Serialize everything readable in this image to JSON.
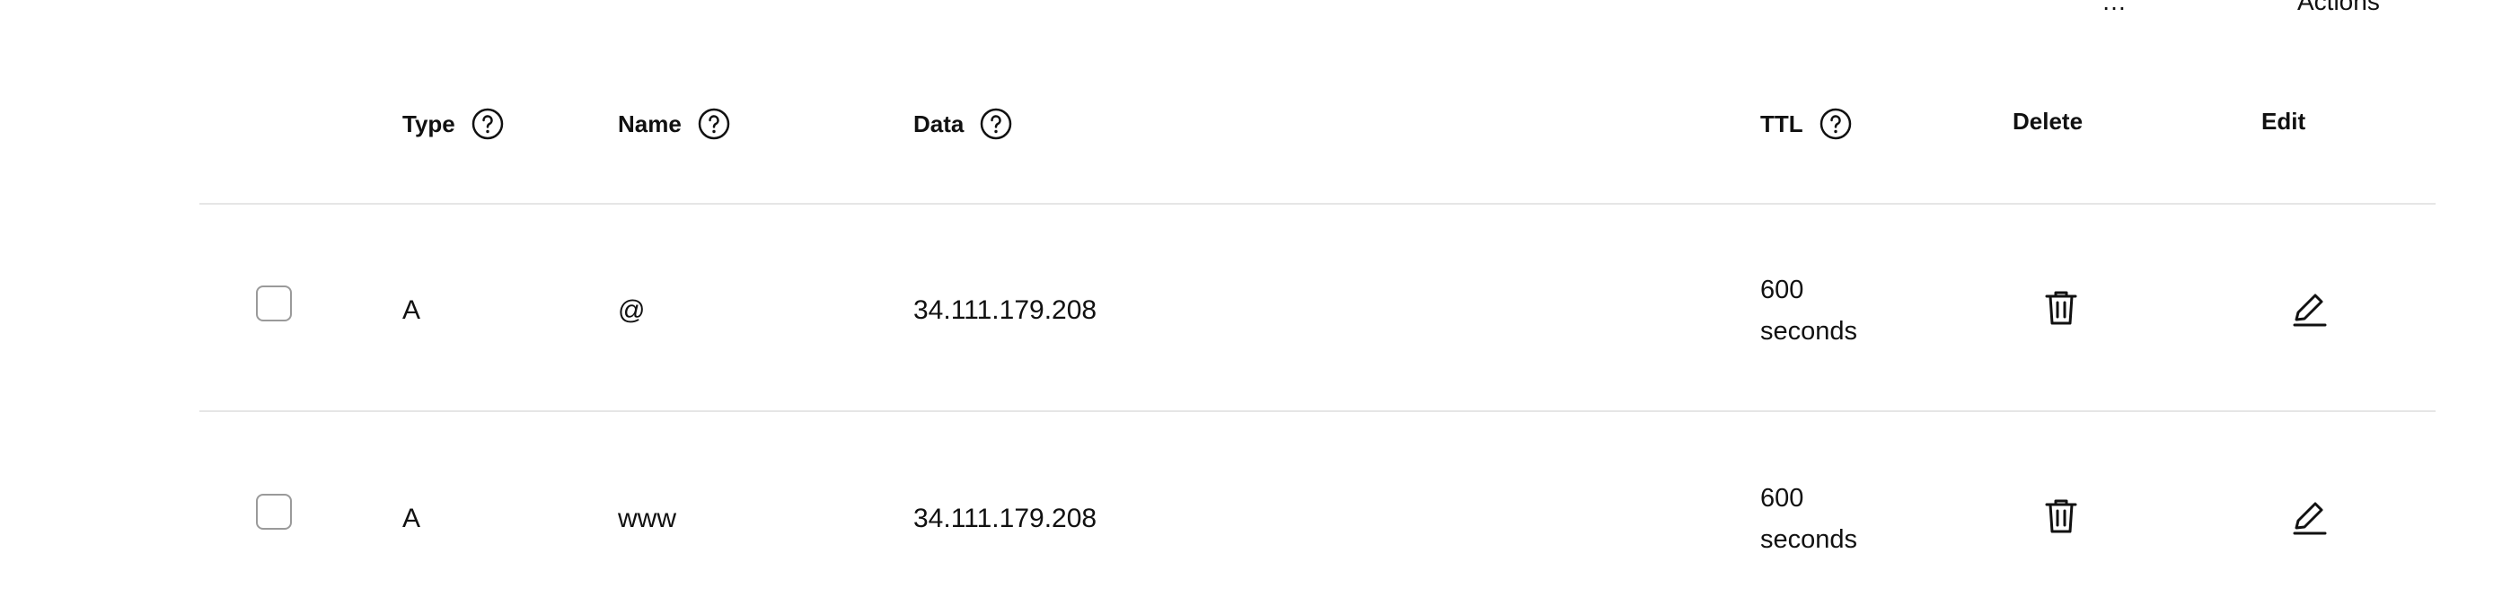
{
  "toolbar": {
    "cut_label_left": "…",
    "actions_label": "Actions"
  },
  "columns": {
    "type": "Type",
    "name": "Name",
    "data": "Data",
    "ttl": "TTL",
    "delete": "Delete",
    "edit": "Edit"
  },
  "rows": [
    {
      "type": "A",
      "name": "@",
      "data": "34.111.179.208",
      "ttl_value": "600",
      "ttl_unit": "seconds",
      "checked": false
    },
    {
      "type": "A",
      "name": "www",
      "data": "34.111.179.208",
      "ttl_value": "600",
      "ttl_unit": "seconds",
      "checked": false
    }
  ],
  "icons": {
    "help": "help-circle-icon",
    "delete": "trash-icon",
    "edit": "pencil-icon"
  }
}
